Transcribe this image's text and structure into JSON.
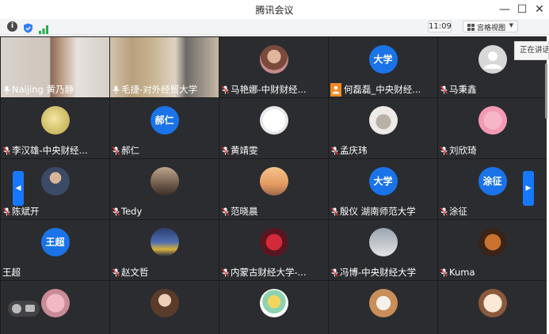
{
  "window": {
    "title": "腾讯会议",
    "min_icon": "—",
    "max_icon": "☐",
    "close_icon": "✕"
  },
  "infobar": {
    "time": "11:09",
    "view_mode": "宫格视图",
    "dropdown_arrow": "▼"
  },
  "speaking_indicator": "正在讲话：",
  "nav": {
    "prev": "◀",
    "next": "▶"
  },
  "colors": {
    "grid_bg": "#1c1c1f",
    "tile_bg": "#2b2c30",
    "accent": "#1677ff",
    "avatar_blue": "#1a73e8",
    "muted_mic": "#e23b3b"
  },
  "participants": [
    {
      "name": "Naijing 黄乃静",
      "mic": "on",
      "kind": "video"
    },
    {
      "name": "毛捷-对外经贸大学",
      "mic": "on",
      "kind": "video"
    },
    {
      "name": "马艳娜-中财财经...",
      "mic": "muted",
      "kind": "photo",
      "avatar_icon": "woman-portrait-icon"
    },
    {
      "name": "何磊磊_中央财经...",
      "mic": "none",
      "kind": "text",
      "avatar_text": "大学",
      "badge_icon": "user-badge-icon"
    },
    {
      "name": "马秉鑫",
      "mic": "muted",
      "kind": "placeholder",
      "avatar_icon": "default-user-icon"
    },
    {
      "name": "李汉雄-中央财经...",
      "mic": "muted",
      "kind": "photo",
      "avatar_icon": "yellow-pattern-icon"
    },
    {
      "name": "郝仁",
      "mic": "muted",
      "kind": "text",
      "avatar_text": "郝仁"
    },
    {
      "name": "黄靖雯",
      "mic": "muted",
      "kind": "photo",
      "avatar_icon": "cartoon-icon"
    },
    {
      "name": "孟庆玮",
      "mic": "muted",
      "kind": "photo",
      "avatar_icon": "cat-icon"
    },
    {
      "name": "刘欣琦",
      "mic": "muted",
      "kind": "photo",
      "avatar_icon": "pink-cartoon-icon"
    },
    {
      "name": "陈斌开",
      "mic": "muted",
      "kind": "photo",
      "avatar_icon": "man-portrait-icon"
    },
    {
      "name": "Tedy",
      "mic": "muted",
      "kind": "photo",
      "avatar_icon": "silhouette-icon"
    },
    {
      "name": "范晓晨",
      "mic": "muted",
      "kind": "photo",
      "avatar_icon": "balloon-icon"
    },
    {
      "name": "殷仪 湖南师范大学",
      "mic": "muted",
      "kind": "text",
      "avatar_text": "大学"
    },
    {
      "name": "涂征",
      "mic": "muted",
      "kind": "text",
      "avatar_text": "涂征"
    },
    {
      "name": "王超",
      "mic": "none",
      "kind": "text",
      "avatar_text": "王超"
    },
    {
      "name": "赵文哲",
      "mic": "muted",
      "kind": "photo",
      "avatar_icon": "lake-icon"
    },
    {
      "name": "内蒙古财经大学-...",
      "mic": "muted",
      "kind": "photo",
      "avatar_icon": "red-figure-icon"
    },
    {
      "name": "冯博-中央财经大学",
      "mic": "muted",
      "kind": "photo",
      "avatar_icon": "building-icon"
    },
    {
      "name": "Kuma",
      "mic": "muted",
      "kind": "photo",
      "avatar_icon": "autumn-icon"
    },
    {
      "name": "",
      "mic": "none",
      "kind": "photo",
      "avatar_icon": "pink-photo-icon"
    },
    {
      "name": "",
      "mic": "none",
      "kind": "photo",
      "avatar_icon": "girl-portrait-icon"
    },
    {
      "name": "",
      "mic": "none",
      "kind": "photo",
      "avatar_icon": "popsicle-icon"
    },
    {
      "name": "",
      "mic": "none",
      "kind": "photo",
      "avatar_icon": "flowers-icon"
    },
    {
      "name": "",
      "mic": "none",
      "kind": "photo",
      "avatar_icon": "anime-girl-icon"
    }
  ]
}
